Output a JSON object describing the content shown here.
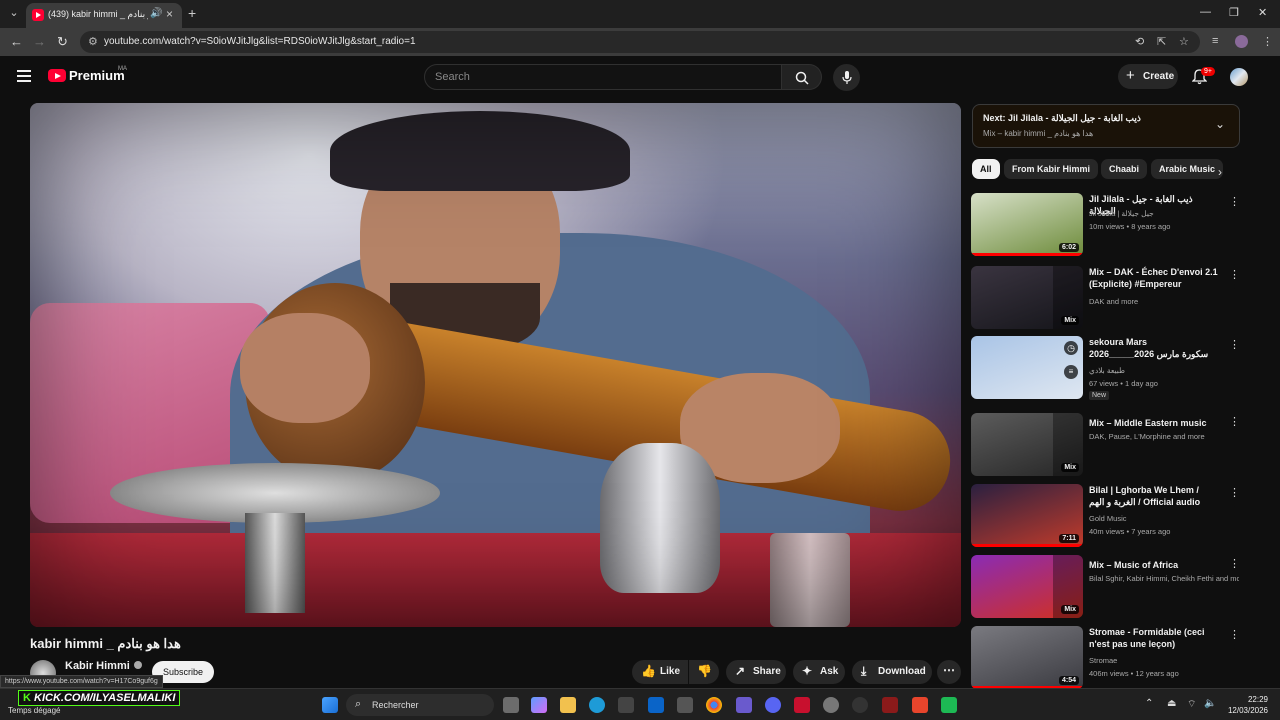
{
  "browser": {
    "tab_title": "(439) kabir himmi _ هدا هو بنادم",
    "url": "youtube.com/watch?v=S0ioWJitJlg&list=RDS0ioWJitJlg&start_radio=1",
    "status_url": "https://www.youtube.com/watch?v=H17Co9guf6g"
  },
  "header": {
    "logo": "Premium",
    "region": "MA",
    "search_placeholder": "Search",
    "create_label": "Create",
    "notif_count": "9+"
  },
  "video": {
    "title": "kabir himmi _ هدا هو بنادم",
    "channel": "Kabir Himmi",
    "subscribe_label": "Subscribe",
    "actions": {
      "like": "Like",
      "share": "Share",
      "ask": "Ask",
      "download": "Download"
    }
  },
  "up_next": {
    "label": "Next:",
    "title": "Jil Jilala - ذيب الغابة - جيل الجيلالة",
    "subtitle": "Mix – kabir himmi _ هدا هو بنادم"
  },
  "chips": [
    "All",
    "From Kabir Himmi",
    "Chaabi",
    "Arabic Music"
  ],
  "recommendations": [
    {
      "title": "Jil Jilala - ذيب الغابة - جيل الجيلالة",
      "channel": "Jil Jilala | جيل جيلالة",
      "meta": "10m views • 8 years ago",
      "duration": "6:02",
      "progress": 1.0,
      "colors": [
        "#d7e0c8",
        "#6d8b3a"
      ]
    },
    {
      "title": "Mix – DAK - Échec D'envoi 2.1 (Explicite) #Empereur",
      "channel": "DAK and more",
      "meta": "",
      "duration": "Mix",
      "colors": [
        "#3a3440",
        "#15151a"
      ]
    },
    {
      "title": "sekoura Mars 2026_____سكورة مارس 2026",
      "channel": "طبيعة بلادي",
      "meta": "67 views • 1 day ago",
      "badge": "New",
      "duration": "",
      "colors": [
        "#a9c4e6",
        "#dfe7f1"
      ]
    },
    {
      "title": "Mix – Middle Eastern music",
      "channel": "DAK, Pause, L'Morphine and more",
      "meta": "",
      "duration": "Mix",
      "colors": [
        "#5c5c5c",
        "#262626"
      ]
    },
    {
      "title": "Bilal | Lghorba We Lhem / الغربة و الهم / Official audio",
      "channel": "Gold Music",
      "meta": "40m views • 7 years ago",
      "duration": "7:11",
      "progress": 1.0,
      "colors": [
        "#2a2040",
        "#c23b2a"
      ]
    },
    {
      "title": "Mix – Music of Africa",
      "channel": "Bilal Sghir, Kabir Himmi, Cheikh Fethi and more",
      "meta": "",
      "duration": "Mix",
      "colors": [
        "#8a2bb5",
        "#d2301f"
      ]
    },
    {
      "title": "Stromae - Formidable (ceci n'est pas une leçon)",
      "channel": "Stromae",
      "meta": "406m views • 12 years ago",
      "duration": "4:54",
      "progress": 1.0,
      "colors": [
        "#7a7a80",
        "#3a3a40"
      ]
    }
  ],
  "taskbar": {
    "weather": "Temps dégagé",
    "overlay": "KICK.COM/ILYASELMALIKI",
    "search_label": "Rechercher",
    "time": "22:29",
    "date": "12/03/2026"
  }
}
